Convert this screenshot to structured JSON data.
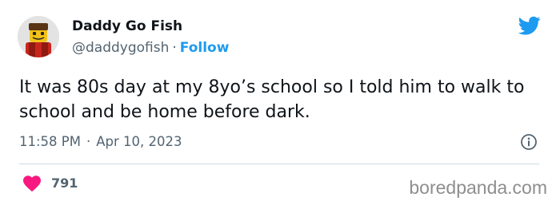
{
  "author": {
    "display_name": "Daddy Go Fish",
    "handle": "@daddygofish",
    "separator": "·",
    "follow_label": "Follow"
  },
  "tweet": {
    "text": "It was 80s day at my 8yo’s school so I told him to walk to school and be home before dark.",
    "time": "11:58 PM",
    "time_separator": "·",
    "date": "Apr 10, 2023"
  },
  "engagement": {
    "likes": "791"
  },
  "watermark": "boredpanda.com",
  "icons": {
    "platform": "twitter-bird-icon",
    "info": "info-icon",
    "like": "heart-icon",
    "avatar": "lego-figure-avatar"
  },
  "colors": {
    "accent": "#1d9bf0",
    "heart": "#f91880",
    "text_primary": "#0f1419",
    "text_secondary": "#536471"
  }
}
